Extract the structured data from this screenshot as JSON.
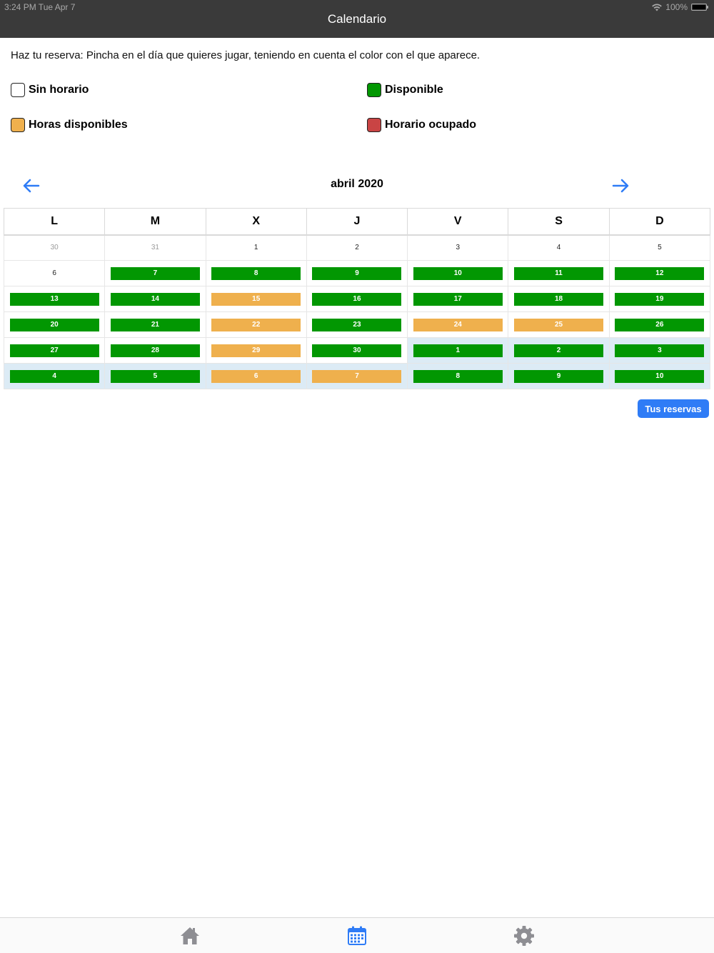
{
  "status_bar": {
    "time": "3:24 PM   Tue Apr 7",
    "battery": "100%"
  },
  "nav": {
    "title": "Calendario"
  },
  "instructions": "Haz tu reserva: Pincha en el día que quieres jugar, teniendo en cuenta el color con el que aparece.",
  "legend": {
    "sin_horario": {
      "label": "Sin horario",
      "color": "#ffffff"
    },
    "disponible": {
      "label": "Disponible",
      "color": "#029702"
    },
    "horas_disponibles": {
      "label": "Horas disponibles",
      "color": "#efb04d"
    },
    "horario_ocupado": {
      "label": "Horario ocupado",
      "color": "#c94444"
    }
  },
  "calendar": {
    "month_label": "abril 2020",
    "prev_icon": "arrow-left-icon",
    "next_icon": "arrow-right-icon",
    "weekdays": [
      "L",
      "M",
      "X",
      "J",
      "V",
      "S",
      "D"
    ],
    "weeks": [
      [
        {
          "day": "30",
          "status": "muted"
        },
        {
          "day": "31",
          "status": "muted"
        },
        {
          "day": "1",
          "status": "plain"
        },
        {
          "day": "2",
          "status": "plain"
        },
        {
          "day": "3",
          "status": "plain"
        },
        {
          "day": "4",
          "status": "plain"
        },
        {
          "day": "5",
          "status": "plain"
        }
      ],
      [
        {
          "day": "6",
          "status": "plain"
        },
        {
          "day": "7",
          "status": "green"
        },
        {
          "day": "8",
          "status": "green"
        },
        {
          "day": "9",
          "status": "green"
        },
        {
          "day": "10",
          "status": "green"
        },
        {
          "day": "11",
          "status": "green"
        },
        {
          "day": "12",
          "status": "green"
        }
      ],
      [
        {
          "day": "13",
          "status": "green"
        },
        {
          "day": "14",
          "status": "green"
        },
        {
          "day": "15",
          "status": "orange"
        },
        {
          "day": "16",
          "status": "green"
        },
        {
          "day": "17",
          "status": "green"
        },
        {
          "day": "18",
          "status": "green"
        },
        {
          "day": "19",
          "status": "green"
        }
      ],
      [
        {
          "day": "20",
          "status": "green"
        },
        {
          "day": "21",
          "status": "green"
        },
        {
          "day": "22",
          "status": "orange"
        },
        {
          "day": "23",
          "status": "green"
        },
        {
          "day": "24",
          "status": "orange"
        },
        {
          "day": "25",
          "status": "orange"
        },
        {
          "day": "26",
          "status": "green"
        }
      ],
      [
        {
          "day": "27",
          "status": "green"
        },
        {
          "day": "28",
          "status": "green"
        },
        {
          "day": "29",
          "status": "orange"
        },
        {
          "day": "30",
          "status": "green"
        },
        {
          "day": "1",
          "status": "green",
          "shaded": true
        },
        {
          "day": "2",
          "status": "green",
          "shaded": true
        },
        {
          "day": "3",
          "status": "green",
          "shaded": true
        }
      ],
      [
        {
          "day": "4",
          "status": "green",
          "shaded": true
        },
        {
          "day": "5",
          "status": "green",
          "shaded": true
        },
        {
          "day": "6",
          "status": "orange",
          "shaded": true
        },
        {
          "day": "7",
          "status": "orange",
          "shaded": true
        },
        {
          "day": "8",
          "status": "green",
          "shaded": true
        },
        {
          "day": "9",
          "status": "green",
          "shaded": true
        },
        {
          "day": "10",
          "status": "green",
          "shaded": true
        }
      ]
    ]
  },
  "reservas_button": {
    "label": "Tus reservas"
  },
  "tabbar": {
    "tabs": [
      {
        "icon": "home-icon",
        "active": false
      },
      {
        "icon": "calendar-icon",
        "active": true
      },
      {
        "icon": "gear-icon",
        "active": false
      }
    ]
  },
  "colors": {
    "accent": "#2f7cf6",
    "inactive_tab": "#8e8e93",
    "navbar": "#3a3a3a"
  }
}
